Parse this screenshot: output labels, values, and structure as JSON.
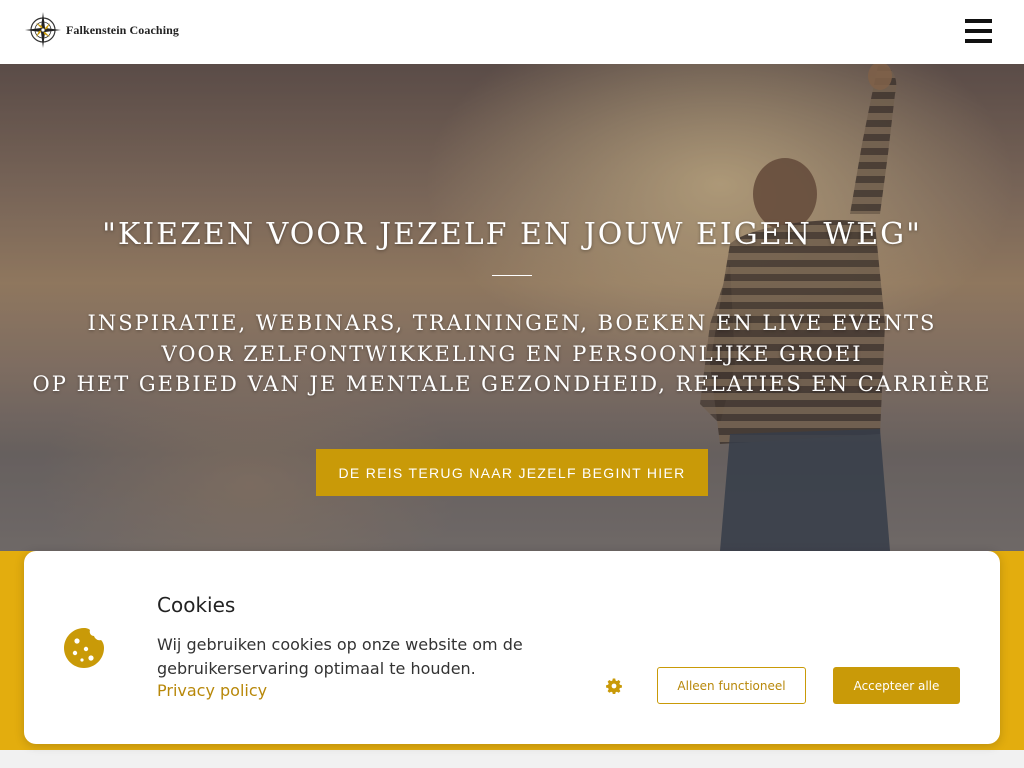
{
  "header": {
    "logo_text": "Falkenstein Coaching",
    "logo_icon": "compass-icon",
    "menu_icon": "hamburger-menu-icon"
  },
  "hero": {
    "title": "\"KIEZEN VOOR JEZELF EN JOUW EIGEN WEG\"",
    "subtitle_lines": [
      "INSPIRATIE, WEBINARS, TRAININGEN, BOEKEN EN LIVE EVENTS",
      "VOOR ZELFONTWIKKELING EN PERSOONLIJKE GROEI",
      "OP HET GEBIED VAN JE MENTALE GEZONDHEID, RELATIES EN CARRIÈRE"
    ],
    "cta_label": "DE REIS TERUG NAAR JEZELF BEGINT HIER"
  },
  "cookie_banner": {
    "title": "Cookies",
    "body": "Wij gebruiken cookies op onze website om de gebruikerservaring optimaal te houden.",
    "privacy_link": "Privacy policy",
    "settings_icon": "gear-icon",
    "cookie_icon": "cookie-icon",
    "functional_button": "Alleen functioneel",
    "accept_button": "Accepteer alle"
  },
  "colors": {
    "accent": "#c99a08",
    "band": "#e3ad0e",
    "header_bg": "#ffffff",
    "hero_text": "#ffffff"
  }
}
